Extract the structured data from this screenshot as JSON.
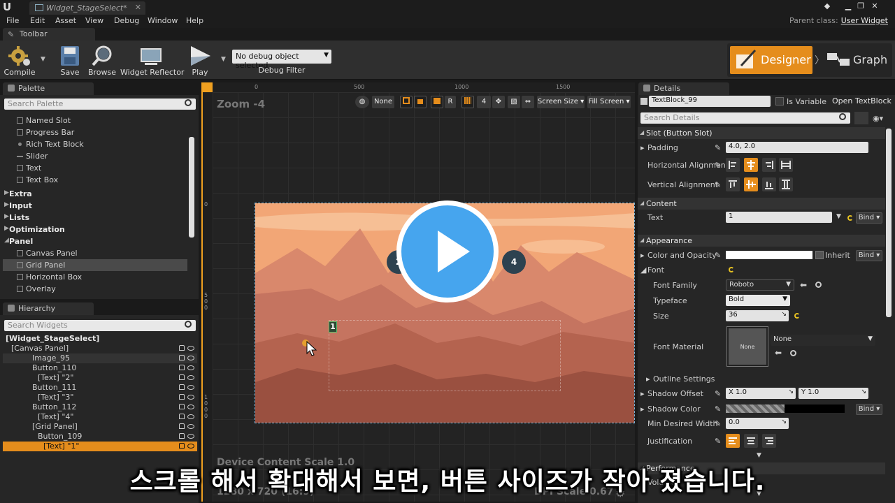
{
  "window": {
    "tab_title": "Widget_StageSelect*",
    "parent_class_label": "Parent class:",
    "parent_class_value": "User Widget"
  },
  "menu": [
    "File",
    "Edit",
    "Asset",
    "View",
    "Debug",
    "Window",
    "Help"
  ],
  "toolbar": {
    "tab_label": "Toolbar",
    "buttons": {
      "compile": "Compile",
      "save": "Save",
      "browse": "Browse",
      "reflector": "Widget Reflector",
      "play": "Play"
    },
    "debug_select": "No debug object selected",
    "debug_filter": "Debug Filter",
    "designer": "Designer",
    "graph": "Graph",
    "accent": "#e58d1c"
  },
  "palette": {
    "tab_label": "Palette",
    "search_placeholder": "Search Palette",
    "items": [
      {
        "label": "Named Slot",
        "kind": "item"
      },
      {
        "label": "Progress Bar",
        "kind": "item"
      },
      {
        "label": "Rich Text Block",
        "kind": "item"
      },
      {
        "label": "Slider",
        "kind": "item"
      },
      {
        "label": "Text",
        "kind": "item"
      },
      {
        "label": "Text Box",
        "kind": "item"
      },
      {
        "label": "Extra",
        "kind": "category"
      },
      {
        "label": "Input",
        "kind": "category"
      },
      {
        "label": "Lists",
        "kind": "category"
      },
      {
        "label": "Optimization",
        "kind": "category"
      },
      {
        "label": "Panel",
        "kind": "category"
      },
      {
        "label": "Canvas Panel",
        "kind": "item"
      },
      {
        "label": "Grid Panel",
        "kind": "item"
      },
      {
        "label": "Horizontal Box",
        "kind": "item"
      },
      {
        "label": "Overlay",
        "kind": "item"
      }
    ]
  },
  "hierarchy": {
    "tab_label": "Hierarchy",
    "search_placeholder": "Search Widgets",
    "items": [
      {
        "label": "[Widget_StageSelect]",
        "indent": 0
      },
      {
        "label": "[Canvas Panel]",
        "indent": 1
      },
      {
        "label": "Image_95",
        "indent": 2
      },
      {
        "label": "Button_110",
        "indent": 2
      },
      {
        "label": "[Text] \"2\"",
        "indent": 3
      },
      {
        "label": "Button_111",
        "indent": 2
      },
      {
        "label": "[Text] \"3\"",
        "indent": 3
      },
      {
        "label": "Button_112",
        "indent": 2
      },
      {
        "label": "[Text] \"4\"",
        "indent": 3
      },
      {
        "label": "[Grid Panel]",
        "indent": 2
      },
      {
        "label": "Button_109",
        "indent": 3
      },
      {
        "label": "[Text] \"1\"",
        "indent": 4
      }
    ]
  },
  "viewport": {
    "zoom": "Zoom -4",
    "ruler_top": [
      "0",
      "500",
      "1000",
      "1500"
    ],
    "ruler_left": [
      "0",
      "500",
      "1000"
    ],
    "ruler_top_corner": "0\n0\n0",
    "tools": {
      "none": "None",
      "r": "R",
      "grid_num": "4",
      "screen_size": "Screen Size",
      "fill_screen": "Fill Screen"
    },
    "buttons_on_canvas": {
      "b1": "1",
      "b2": "2",
      "b4": "4"
    },
    "device_scale": "Device Content Scale 1.0",
    "resolution": "1280 x 720 (16:9)",
    "dpi": "DPI Scale 0.67"
  },
  "details": {
    "tab_label": "Details",
    "widget_name": "TextBlock_99",
    "is_variable": "Is Variable",
    "open_link": "Open TextBlock",
    "search_placeholder": "Search Details",
    "sections": {
      "slot": "Slot (Button Slot)",
      "content": "Content",
      "appearance": "Appearance",
      "performance": "Performance"
    },
    "padding_label": "Padding",
    "padding_value": "4.0, 2.0",
    "halign_label": "Horizontal Alignmen",
    "valign_label": "Vertical Alignment",
    "text_label": "Text",
    "text_value": "1",
    "bind": "Bind",
    "color_label": "Color and Opacity",
    "inherit": "Inherit",
    "font_label": "Font",
    "font_family_label": "Font Family",
    "font_family_value": "Roboto",
    "typeface_label": "Typeface",
    "typeface_value": "Bold",
    "size_label": "Size",
    "size_value": "36",
    "font_material_label": "Font Material",
    "font_material_thumb": "None",
    "font_material_value": "None",
    "outline_label": "Outline Settings",
    "shadow_offset_label": "Shadow Offset",
    "shadow_x": "X  1.0",
    "shadow_y": "Y  1.0",
    "shadow_color_label": "Shadow Color",
    "min_width_label": "Min Desired Width",
    "min_width_value": "0.0",
    "justification_label": "Justification",
    "volatile_label": "Volatile"
  },
  "subtitle": "스크롤 해서 확대해서 보면, 버튼 사이즈가 작아 졌습니다."
}
